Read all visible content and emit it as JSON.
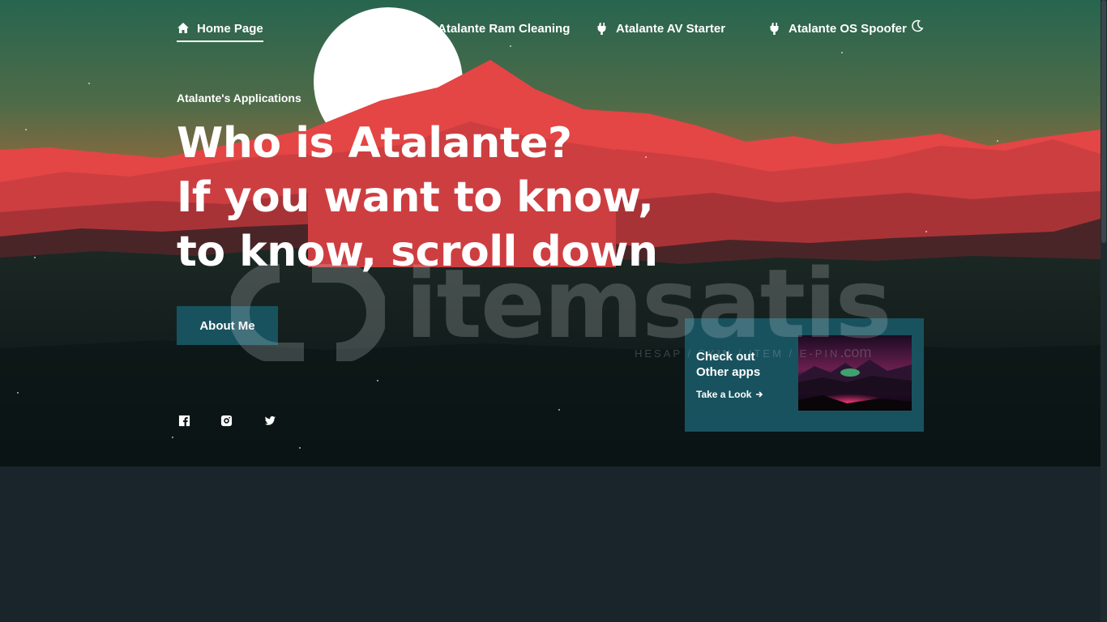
{
  "nav": {
    "items": [
      {
        "label": "Home Page",
        "icon": "home-icon"
      },
      {
        "label": "Atalante Ram Cleaning",
        "icon": "plug-icon"
      },
      {
        "label": "Atalante AV Starter",
        "icon": "plug-icon"
      },
      {
        "label": "Atalante OS Spoofer",
        "icon": "plug-icon"
      }
    ],
    "theme_toggle_icon": "moon-icon"
  },
  "hero": {
    "kicker": "Atalante's Applications",
    "line1": "Who is Atalante?",
    "line2_regular": "If you want ",
    "line2_bold": "to know,",
    "line3_bold": "to know, scroll down",
    "cta_label": "About Me"
  },
  "social": [
    "facebook-icon",
    "instagram-icon",
    "twitter-icon"
  ],
  "card": {
    "title_line1": "Check out",
    "title_line2": "Other apps",
    "link_label": "Take a Look",
    "link_icon": "arrow-right-icon"
  },
  "watermark": {
    "brand": "itemsatis",
    "tagline": "HESAP / SKIN / ITEM / E-PIN",
    "domain": ".com"
  },
  "colors": {
    "accent": "#18525f",
    "background": "#1a252b",
    "mountain_red": "#e44545"
  }
}
